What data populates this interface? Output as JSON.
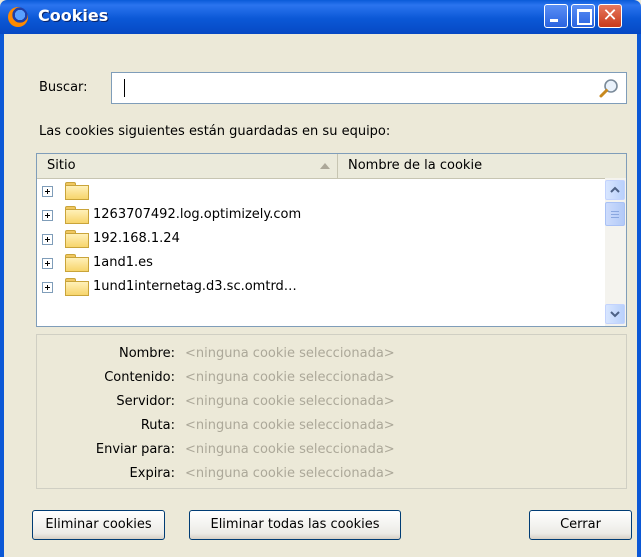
{
  "window": {
    "title": "Cookies",
    "controls": {
      "minimize": "minimize-icon",
      "maximize": "maximize-icon",
      "close": "close-icon"
    }
  },
  "search": {
    "label": "Buscar:",
    "value": "",
    "icon": "magnifier-icon"
  },
  "info_text": "Las cookies siguientes están guardadas en su equipo:",
  "table": {
    "columns": [
      "Sitio",
      "Nombre de la cookie"
    ],
    "sort_column": "Sitio",
    "rows": [
      {
        "site": "",
        "cookie": ""
      },
      {
        "site": "1263707492.log.optimizely.com",
        "cookie": ""
      },
      {
        "site": "192.168.1.24",
        "cookie": ""
      },
      {
        "site": "1and1.es",
        "cookie": ""
      },
      {
        "site": "1und1internetag.d3.sc.omtrd…",
        "cookie": ""
      }
    ]
  },
  "details": {
    "fields": [
      {
        "label": "Nombre:",
        "value": "<ninguna cookie seleccionada>"
      },
      {
        "label": "Contenido:",
        "value": "<ninguna cookie seleccionada>"
      },
      {
        "label": "Servidor:",
        "value": "<ninguna cookie seleccionada>"
      },
      {
        "label": "Ruta:",
        "value": "<ninguna cookie seleccionada>"
      },
      {
        "label": "Enviar para:",
        "value": "<ninguna cookie seleccionada>"
      },
      {
        "label": "Expira:",
        "value": "<ninguna cookie seleccionada>"
      }
    ]
  },
  "buttons": {
    "remove": "Eliminar cookies",
    "remove_all": "Eliminar todas las cookies",
    "close": "Cerrar"
  },
  "colors": {
    "titlebar": "#0b58d6",
    "dialog_bg": "#ece9d8",
    "close_button": "#c7391a",
    "placeholder_text": "#aca899"
  }
}
